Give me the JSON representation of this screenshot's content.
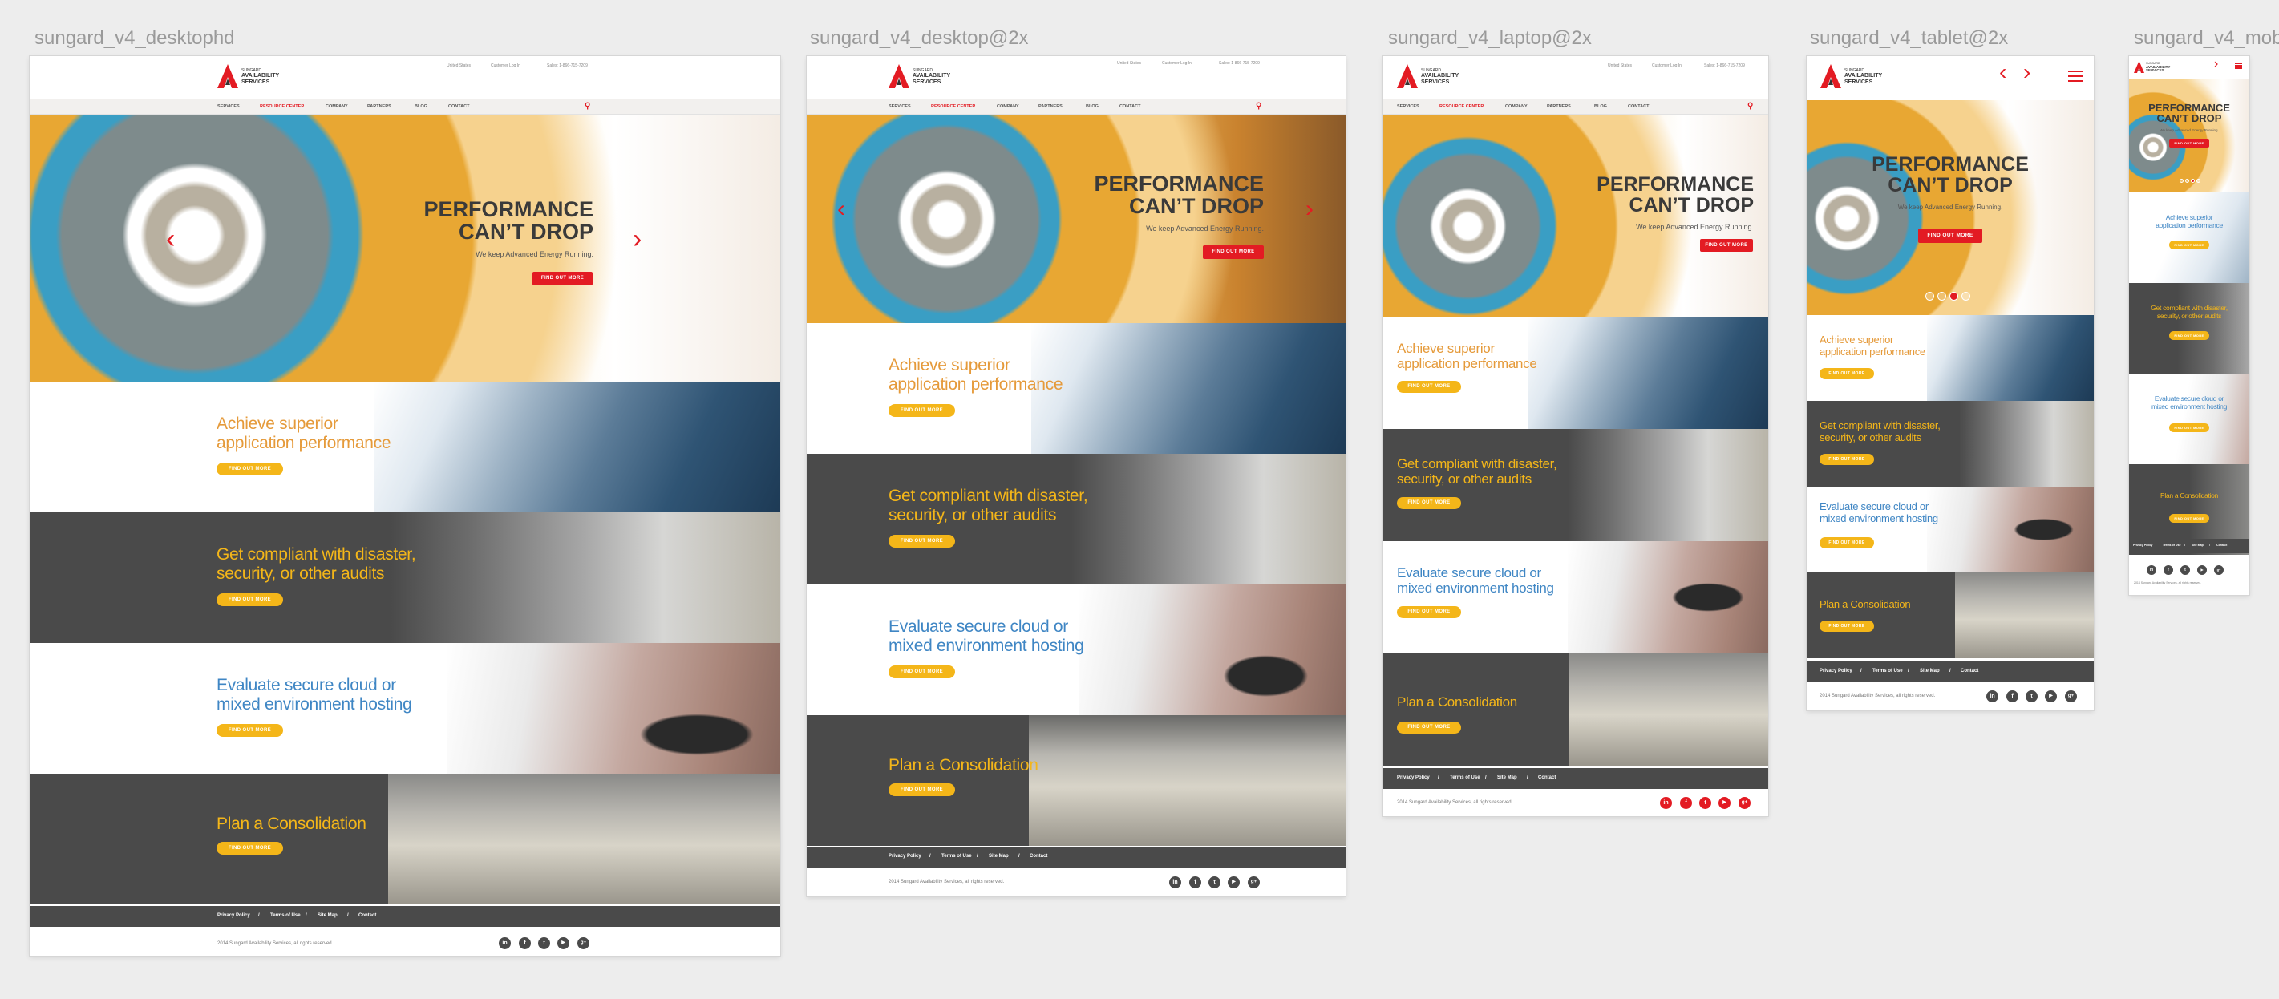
{
  "artboards": {
    "desktophd": {
      "caption": "sungard_v4_desktophd"
    },
    "desktop": {
      "caption": "sungard_v4_desktop@2x"
    },
    "laptop": {
      "caption": "sungard_v4_laptop@2x"
    },
    "tablet": {
      "caption": "sungard_v4_tablet@2x"
    },
    "mobile": {
      "caption": "sungard_v4_mob"
    }
  },
  "brand": {
    "logo_line1": "SUNGARD",
    "logo_line2": "AVAILABILITY",
    "logo_line3": "SERVICES",
    "accent": "#e31b23",
    "button_yellow": "#f4b619",
    "dark_band": "#4a4a4a",
    "orange_text": "#e59a3a",
    "yellow_text": "#f4b619",
    "blue_text": "#3f86c4"
  },
  "utility_nav": {
    "region": "United States",
    "login": "Customer Log In",
    "sales": "Sales: 1-866-715-7209"
  },
  "main_nav": [
    "SERVICES",
    "RESOURCE CENTER",
    "COMPANY",
    "PARTNERS",
    "BLOG",
    "CONTACT"
  ],
  "hero": {
    "title_line1": "PERFORMANCE",
    "title_line2": "CAN’T DROP",
    "subtitle": "We keep Advanced Energy Running.",
    "cta": "FIND OUT MORE"
  },
  "banners": [
    {
      "line1": "Achieve superior",
      "line2": "application performance",
      "cta": "FIND OUT MORE"
    },
    {
      "line1": "Get compliant with disaster,",
      "line2": "security, or other audits",
      "cta": "FIND OUT MORE"
    },
    {
      "line1": "Evaluate secure cloud or",
      "line2": "mixed environment hosting",
      "cta": "FIND OUT MORE"
    },
    {
      "line1": "Plan a Consolidation",
      "line2": "",
      "cta": "FIND OUT MORE"
    }
  ],
  "footer": {
    "links": [
      "Privacy Policy",
      "Terms of Use",
      "Site Map",
      "Contact"
    ],
    "separator": "/",
    "copyright": "2014 Sungard Availability Services, all rights reserved."
  },
  "social_icons": [
    "linkedin-icon",
    "facebook-icon",
    "twitter-icon",
    "youtube-icon",
    "googleplus-icon"
  ],
  "social_glyphs": [
    "in",
    "f",
    "t",
    "▶",
    "g+"
  ],
  "icons": {
    "search": "⚲",
    "prev": "‹",
    "next": "›",
    "menu": "☰"
  }
}
